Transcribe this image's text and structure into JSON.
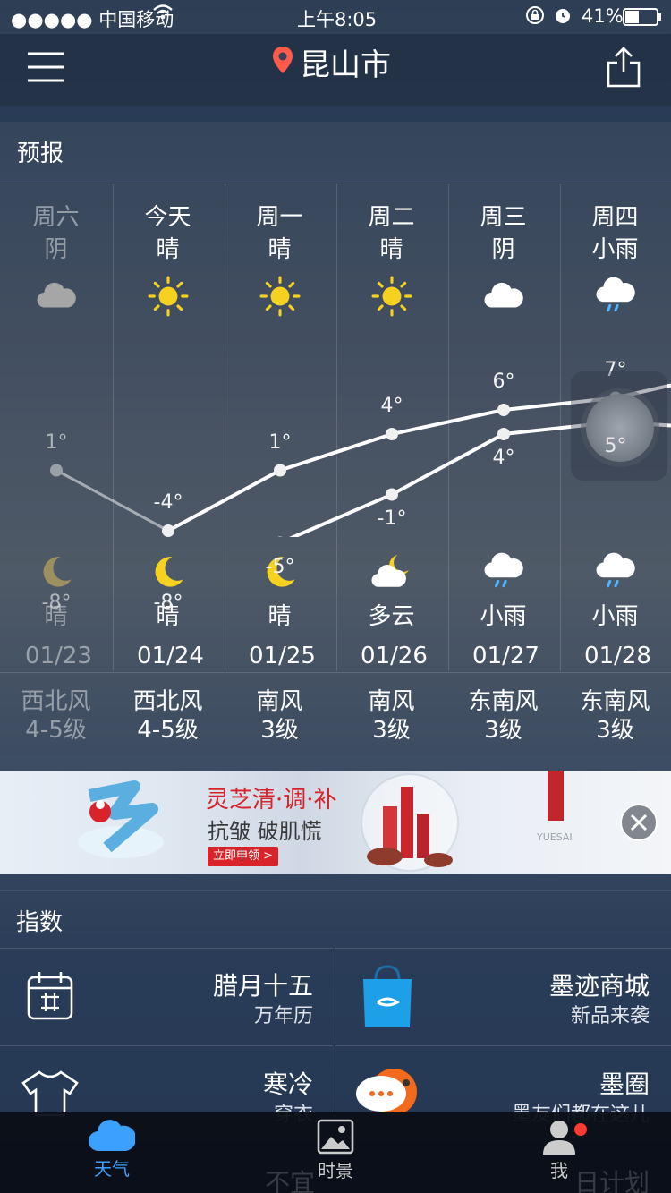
{
  "status_bar": {
    "carrier": "●●●●● 中国移动",
    "time": "上午8:05",
    "battery": "41%"
  },
  "header": {
    "city": "昆山市"
  },
  "forecast": {
    "title": "预报",
    "days": [
      {
        "day": "周六",
        "cond": "阴",
        "icon": "cloud-icon",
        "high": "1°",
        "low": "-8°",
        "night_icon": "moon-icon",
        "night_cond": "晴",
        "date": "01/23",
        "wind": "西北风",
        "wind_level": "4-5级",
        "dim": true
      },
      {
        "day": "今天",
        "cond": "晴",
        "icon": "sun-icon",
        "high": "-4°",
        "low": "-8°",
        "night_icon": "moon-icon",
        "night_cond": "晴",
        "date": "01/24",
        "wind": "西北风",
        "wind_level": "4-5级",
        "dim": false
      },
      {
        "day": "周一",
        "cond": "晴",
        "icon": "sun-icon",
        "high": "1°",
        "low": "-5°",
        "night_icon": "moon-icon",
        "night_cond": "晴",
        "date": "01/25",
        "wind": "南风",
        "wind_level": "3级",
        "dim": false
      },
      {
        "day": "周二",
        "cond": "晴",
        "icon": "sun-icon",
        "high": "4°",
        "low": "-1°",
        "night_icon": "partly-cloudy-night-icon",
        "night_cond": "多云",
        "date": "01/26",
        "wind": "南风",
        "wind_level": "3级",
        "dim": false
      },
      {
        "day": "周三",
        "cond": "阴",
        "icon": "cloud-icon",
        "high": "6°",
        "low": "4°",
        "night_icon": "rain-icon",
        "night_cond": "小雨",
        "date": "01/27",
        "wind": "东南风",
        "wind_level": "3级",
        "dim": false
      },
      {
        "day": "周四",
        "cond": "小雨",
        "icon": "rain-icon",
        "high": "7°",
        "low": "5°",
        "night_icon": "rain-icon",
        "night_cond": "小雨",
        "date": "01/28",
        "wind": "东南风",
        "wind_level": "3级",
        "dim": false
      }
    ]
  },
  "ad": {
    "headline1": "灵芝清·调·补",
    "headline2": "抗皱 破肌慌",
    "cta": "立即申领 >",
    "brand": "YUESAI"
  },
  "index": {
    "title": "指数",
    "items": [
      {
        "title": "腊月十五",
        "subtitle": "万年历",
        "icon": "calendar-icon"
      },
      {
        "title": "墨迹商城",
        "subtitle": "新品来袭",
        "icon": "shopping-bag-icon"
      },
      {
        "title": "寒冷",
        "subtitle": "穿衣",
        "icon": "shirt-icon"
      },
      {
        "title": "墨圈",
        "subtitle": "墨友们都在这儿",
        "icon": "chat-bubble-icon"
      }
    ]
  },
  "tabbar": {
    "items": [
      {
        "label": "天气",
        "active": true
      },
      {
        "label": "时景",
        "active": false
      },
      {
        "label": "我",
        "active": false
      }
    ],
    "behind": [
      "不宜",
      "日计划"
    ]
  },
  "colors": {
    "accent": "#3ca0ff",
    "pin": "#ff5a4a",
    "sun": "#f7d11f"
  }
}
